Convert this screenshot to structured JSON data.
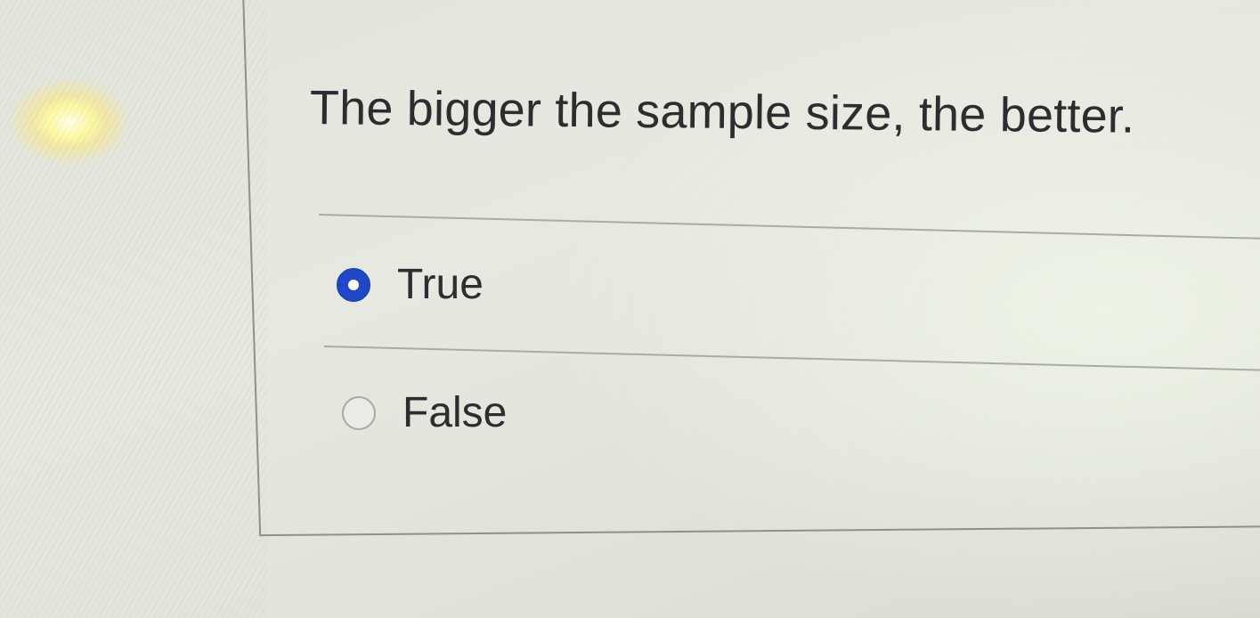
{
  "question": {
    "text": "The bigger the sample size, the better."
  },
  "options": [
    {
      "label": "True",
      "selected": true
    },
    {
      "label": "False",
      "selected": false
    }
  ],
  "colors": {
    "radio_selected": "#1f47c7",
    "text": "#2b2d30",
    "divider": "#a9aca6"
  }
}
